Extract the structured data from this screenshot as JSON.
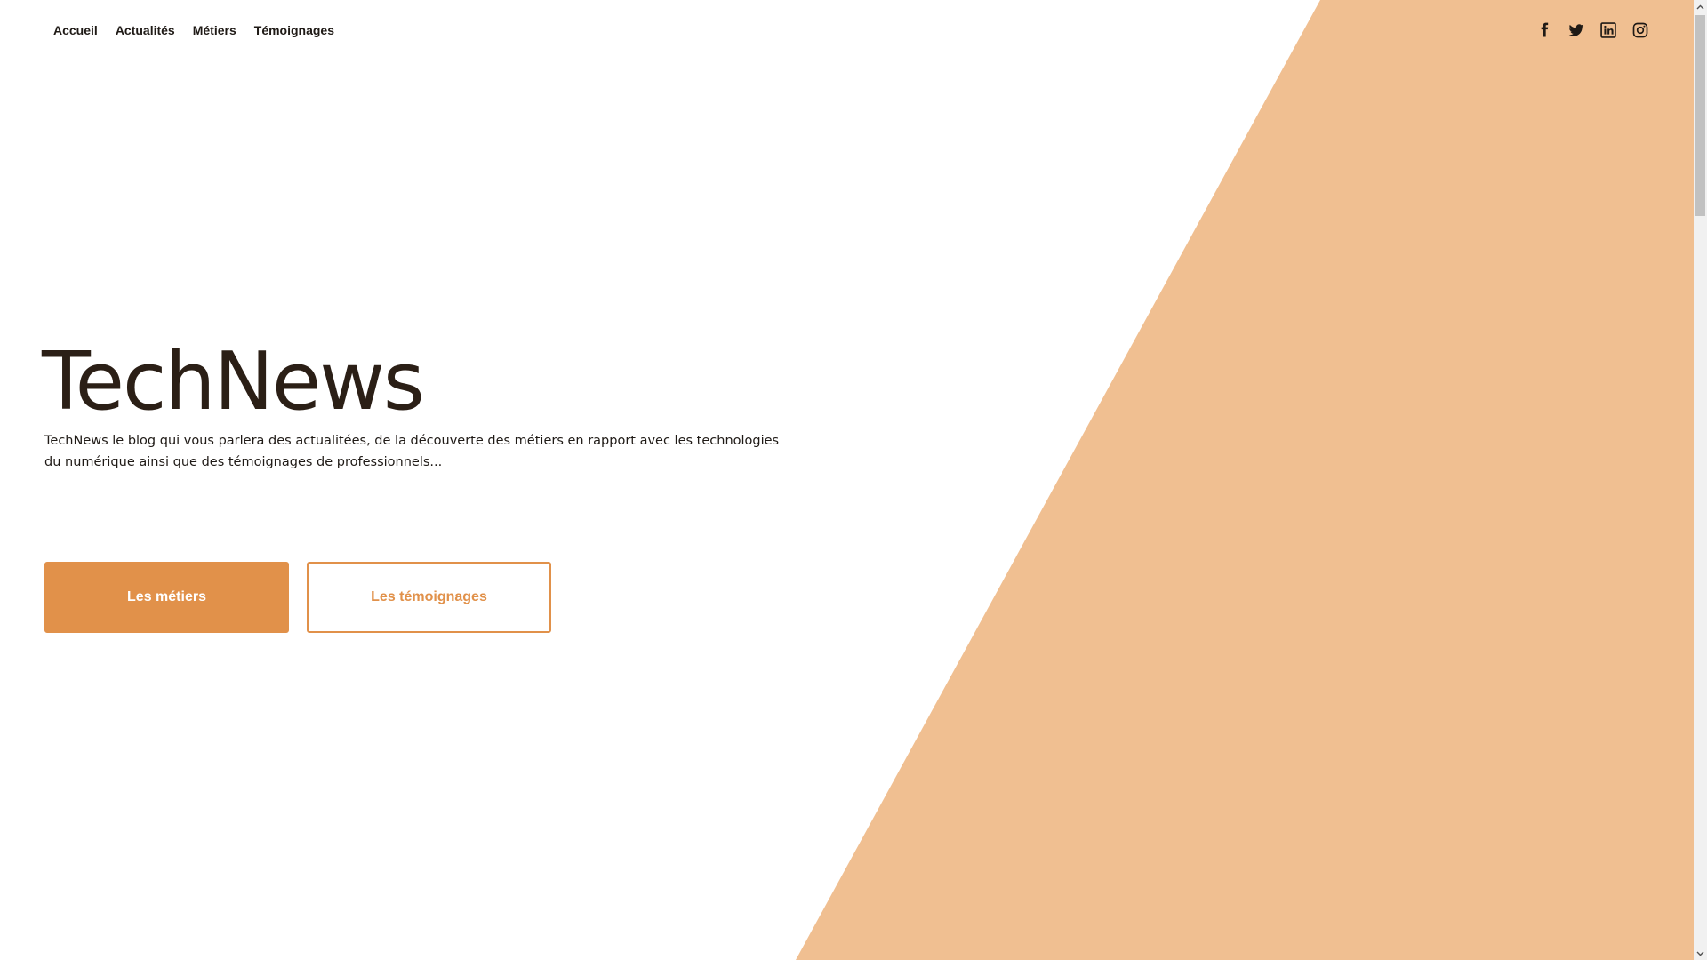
{
  "nav": {
    "items": [
      {
        "label": "Accueil"
      },
      {
        "label": "Actualités"
      },
      {
        "label": "Métiers"
      },
      {
        "label": "Témoignages"
      }
    ]
  },
  "socials": [
    {
      "icon": "facebook-icon"
    },
    {
      "icon": "twitter-icon"
    },
    {
      "icon": "linkedin-icon"
    },
    {
      "icon": "instagram-icon"
    }
  ],
  "hero": {
    "title": "TechNews",
    "description": "TechNews le blog qui vous parlera des actualitées, de la découverte des métiers en rapport avec les technologies du numérique ainsi que des témoignages de professionnels...",
    "primary_button": "Les métiers",
    "secondary_button": "Les témoignages"
  },
  "colors": {
    "accent": "#e1914a",
    "hero_shape": "#f0bf91",
    "text": "#2b1f16"
  },
  "icons": {
    "scroll_up": "chevron-up-icon",
    "scroll_down": "chevron-down-icon"
  }
}
